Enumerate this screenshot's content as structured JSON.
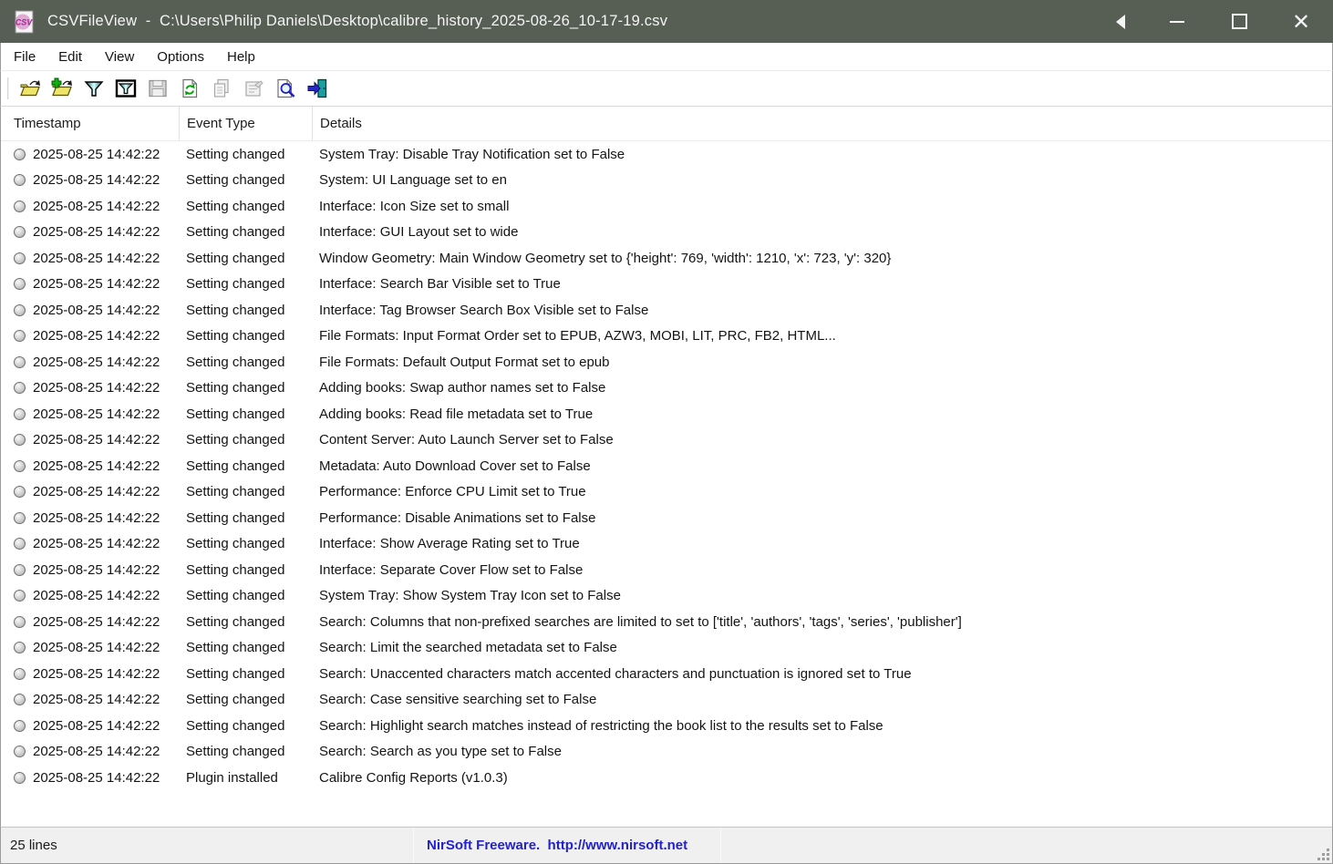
{
  "window": {
    "title": "CSVFileView  -  C:\\Users\\Philip Daniels\\Desktop\\calibre_history_2025-08-26_10-17-19.csv",
    "app_name": "CSVFileView",
    "controls": {
      "back_icon": "triangle-left-icon",
      "minimize_icon": "minimize-icon",
      "maximize_icon": "maximize-icon",
      "close_icon": "close-icon"
    }
  },
  "colors": {
    "titlebar_bg": "#575f55",
    "titlebar_text": "#f5f5f5",
    "link_blue": "#2222cc",
    "statusbar_bg": "#f0f0f0",
    "funnel_teal": "#0a6a6a",
    "folder_yellow": "#efe46a",
    "row_text": "#141414"
  },
  "menu": {
    "items": [
      "File",
      "Edit",
      "View",
      "Options",
      "Help"
    ]
  },
  "toolbar": {
    "buttons": [
      {
        "icon": "open-file-icon",
        "disabled": false
      },
      {
        "icon": "open-add-file-icon",
        "disabled": false
      },
      {
        "icon": "filter-funnel-icon",
        "disabled": false
      },
      {
        "icon": "display-filter-icon",
        "disabled": false
      },
      {
        "icon": "save-icon",
        "disabled": true
      },
      {
        "icon": "refresh-icon",
        "disabled": false
      },
      {
        "icon": "copy-icon",
        "disabled": true
      },
      {
        "icon": "properties-icon",
        "disabled": true
      },
      {
        "icon": "find-icon",
        "disabled": false
      },
      {
        "icon": "exit-icon",
        "disabled": false
      }
    ]
  },
  "table": {
    "columns": [
      "Timestamp",
      "Event Type",
      "Details"
    ],
    "row_bullet_icon": "sphere-bullet-icon",
    "rows": [
      {
        "timestamp": "2025-08-25 14:42:22",
        "event_type": "Setting changed",
        "details": "System Tray: Disable Tray Notification set to False"
      },
      {
        "timestamp": "2025-08-25 14:42:22",
        "event_type": "Setting changed",
        "details": "System: UI Language set to en"
      },
      {
        "timestamp": "2025-08-25 14:42:22",
        "event_type": "Setting changed",
        "details": "Interface: Icon Size set to small"
      },
      {
        "timestamp": "2025-08-25 14:42:22",
        "event_type": "Setting changed",
        "details": "Interface: GUI Layout set to wide"
      },
      {
        "timestamp": "2025-08-25 14:42:22",
        "event_type": "Setting changed",
        "details": "Window Geometry: Main Window Geometry set to {'height': 769, 'width': 1210, 'x': 723, 'y': 320}"
      },
      {
        "timestamp": "2025-08-25 14:42:22",
        "event_type": "Setting changed",
        "details": "Interface: Search Bar Visible set to True"
      },
      {
        "timestamp": "2025-08-25 14:42:22",
        "event_type": "Setting changed",
        "details": "Interface: Tag Browser Search Box Visible set to False"
      },
      {
        "timestamp": "2025-08-25 14:42:22",
        "event_type": "Setting changed",
        "details": "File Formats: Input Format Order set to EPUB, AZW3, MOBI, LIT, PRC, FB2, HTML..."
      },
      {
        "timestamp": "2025-08-25 14:42:22",
        "event_type": "Setting changed",
        "details": "File Formats: Default Output Format set to epub"
      },
      {
        "timestamp": "2025-08-25 14:42:22",
        "event_type": "Setting changed",
        "details": "Adding books: Swap author names set to False"
      },
      {
        "timestamp": "2025-08-25 14:42:22",
        "event_type": "Setting changed",
        "details": "Adding books: Read file metadata set to True"
      },
      {
        "timestamp": "2025-08-25 14:42:22",
        "event_type": "Setting changed",
        "details": "Content Server: Auto Launch Server set to False"
      },
      {
        "timestamp": "2025-08-25 14:42:22",
        "event_type": "Setting changed",
        "details": "Metadata: Auto Download Cover set to False"
      },
      {
        "timestamp": "2025-08-25 14:42:22",
        "event_type": "Setting changed",
        "details": "Performance: Enforce CPU Limit set to True"
      },
      {
        "timestamp": "2025-08-25 14:42:22",
        "event_type": "Setting changed",
        "details": "Performance: Disable Animations set to False"
      },
      {
        "timestamp": "2025-08-25 14:42:22",
        "event_type": "Setting changed",
        "details": "Interface: Show Average Rating set to True"
      },
      {
        "timestamp": "2025-08-25 14:42:22",
        "event_type": "Setting changed",
        "details": "Interface: Separate Cover Flow set to False"
      },
      {
        "timestamp": "2025-08-25 14:42:22",
        "event_type": "Setting changed",
        "details": "System Tray: Show System Tray Icon set to False"
      },
      {
        "timestamp": "2025-08-25 14:42:22",
        "event_type": "Setting changed",
        "details": "Search: Columns that non-prefixed searches are limited to set to ['title', 'authors', 'tags', 'series', 'publisher']"
      },
      {
        "timestamp": "2025-08-25 14:42:22",
        "event_type": "Setting changed",
        "details": "Search: Limit the searched metadata set to False"
      },
      {
        "timestamp": "2025-08-25 14:42:22",
        "event_type": "Setting changed",
        "details": "Search: Unaccented characters match accented characters and punctuation is ignored set to True"
      },
      {
        "timestamp": "2025-08-25 14:42:22",
        "event_type": "Setting changed",
        "details": "Search: Case sensitive searching set to False"
      },
      {
        "timestamp": "2025-08-25 14:42:22",
        "event_type": "Setting changed",
        "details": "Search: Highlight search matches instead of restricting the book list to the results set to False"
      },
      {
        "timestamp": "2025-08-25 14:42:22",
        "event_type": "Setting changed",
        "details": "Search: Search as you type set to False"
      },
      {
        "timestamp": "2025-08-25 14:42:22",
        "event_type": "Plugin installed",
        "details": "Calibre Config Reports (v1.0.3)"
      }
    ]
  },
  "statusbar": {
    "lines_count": "25 lines",
    "link": "NirSoft Freeware.  http://www.nirsoft.net"
  }
}
